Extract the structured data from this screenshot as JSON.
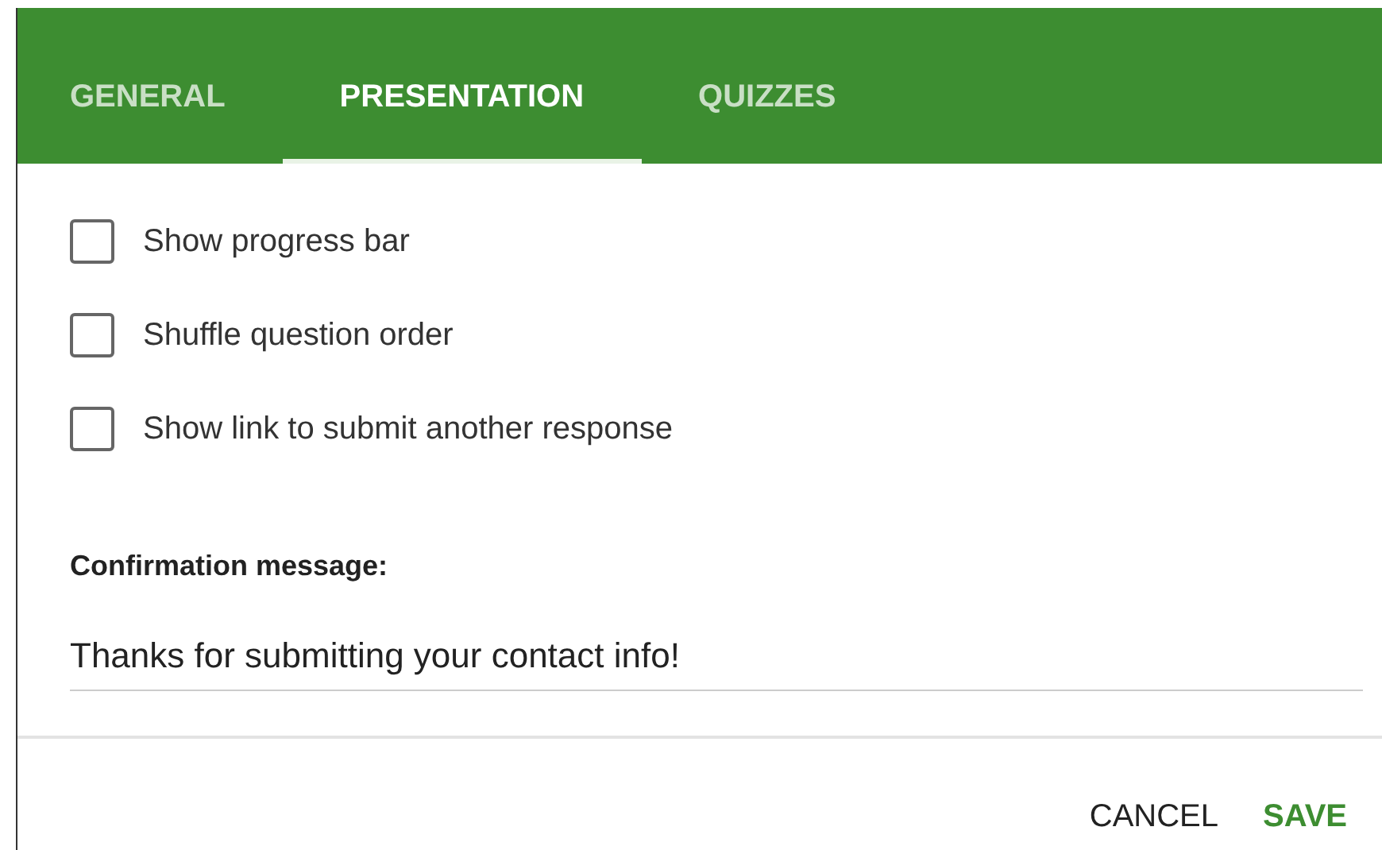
{
  "tabs": [
    {
      "label": "GENERAL",
      "selected": false
    },
    {
      "label": "PRESENTATION",
      "selected": true
    },
    {
      "label": "QUIZZES",
      "selected": false
    }
  ],
  "options": [
    {
      "label": "Show progress bar",
      "checked": false
    },
    {
      "label": "Shuffle question order",
      "checked": false
    },
    {
      "label": "Show link to submit another response",
      "checked": false
    }
  ],
  "confirmation": {
    "label": "Confirmation message:",
    "value": "Thanks for submitting your contact info!"
  },
  "buttons": [
    {
      "label": "CANCEL",
      "kind": "secondary"
    },
    {
      "label": "SAVE",
      "kind": "primary"
    }
  ]
}
